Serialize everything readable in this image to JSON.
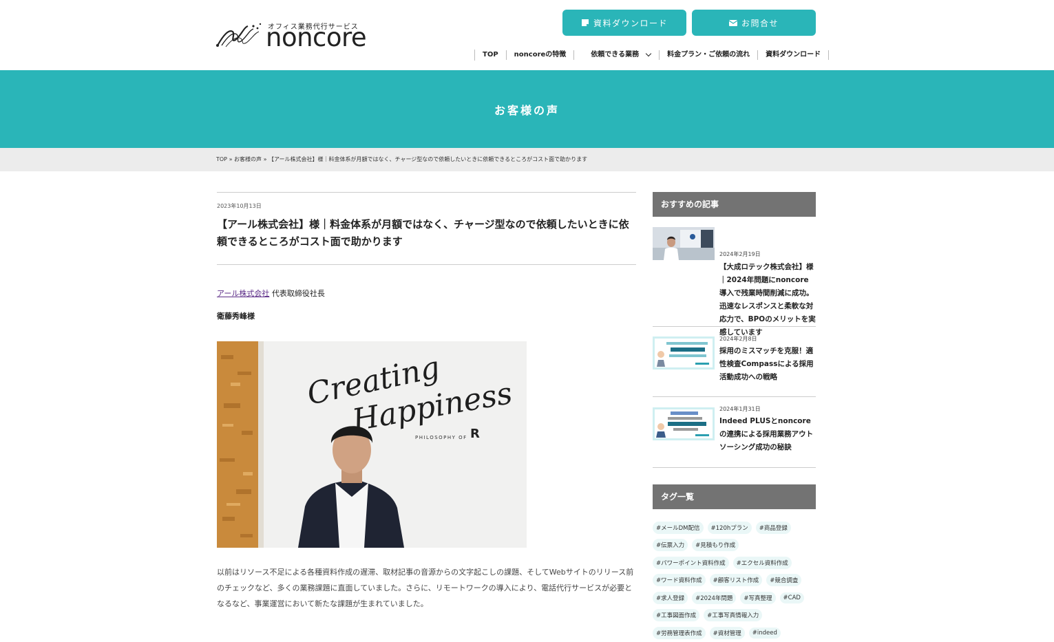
{
  "header": {
    "tagline": "オフィス業務代行サービス",
    "brand": "noncore",
    "download_button": "資料ダウンロード",
    "contact_button": "お問合せ",
    "accent_color": "#2ab5b8"
  },
  "nav": {
    "items": [
      "TOP",
      "noncoreの特徴",
      "依頼できる業務",
      "料金プラン・ご依頼の流れ",
      "資料ダウンロード"
    ]
  },
  "hero": {
    "title": "お客様の声"
  },
  "breadcrumb": {
    "top": "TOP",
    "sep": "»",
    "voice": "お客様の声",
    "current": "【アール株式会社】様｜料金体系が月額ではなく、チャージ型なので依頼したいときに依頼できるところがコスト面で助かります"
  },
  "article": {
    "date": "2023年10月13日",
    "title": "【アール株式会社】様｜料金体系が月額ではなく、チャージ型なので依頼したいときに依頼できるところがコスト面で助かります",
    "company_link": "アール株式会社",
    "role": " 代表取締役社長",
    "person": "衛藤秀峰様",
    "photo_text": [
      "Creating",
      "Happiness",
      "PHILOSOPHY OF"
    ],
    "body": "以前はリソース不足による各種資料作成の遅滞、取材記事の音源からの文字起こしの課題、そしてWebサイトのリリース前のチェックなど、多くの業務課題に直面していました。さらに、リモートワークの導入により、電話代行サービスが必要となるなど、事業運営において新たな課題が生まれていました。"
  },
  "sidebar": {
    "recommended_heading": "おすすめの記事",
    "recommended": [
      {
        "date": "2024年2月19日",
        "title": "【大成ロテック株式会社】様｜2024年問題にnoncore導入で残業時間削減に成功。迅速なレスポンスと柔軟な対応力で、BPOのメリットを実感しています"
      },
      {
        "date": "2024年2月8日",
        "title": "採用のミスマッチを克服！適性検査Compassによる採用活動成功への戦略"
      },
      {
        "date": "2024年1月31日",
        "title": "Indeed PLUSとnoncoreの連携による採用業務アウトソーシング成功の秘訣"
      }
    ],
    "tags_heading": "タグ一覧",
    "tag_rows": [
      [
        "#メールDM配信",
        "#120hプラン",
        "#商品登録"
      ],
      [
        "#伝票入力",
        "#見積もり作成"
      ],
      [
        "#パワーポイント資料作成",
        "#エクセル資料作成"
      ],
      [
        "#ワード資料作成",
        "#顧客リスト作成",
        "#競合調査"
      ],
      [
        "#求人登録",
        "#2024年問題",
        "#写真整理",
        "#CAD"
      ],
      [
        "#工事図面作成",
        "#工事写真情報入力"
      ],
      [
        "#労務管理表作成",
        "#資材管理",
        "#indeed"
      ]
    ]
  }
}
